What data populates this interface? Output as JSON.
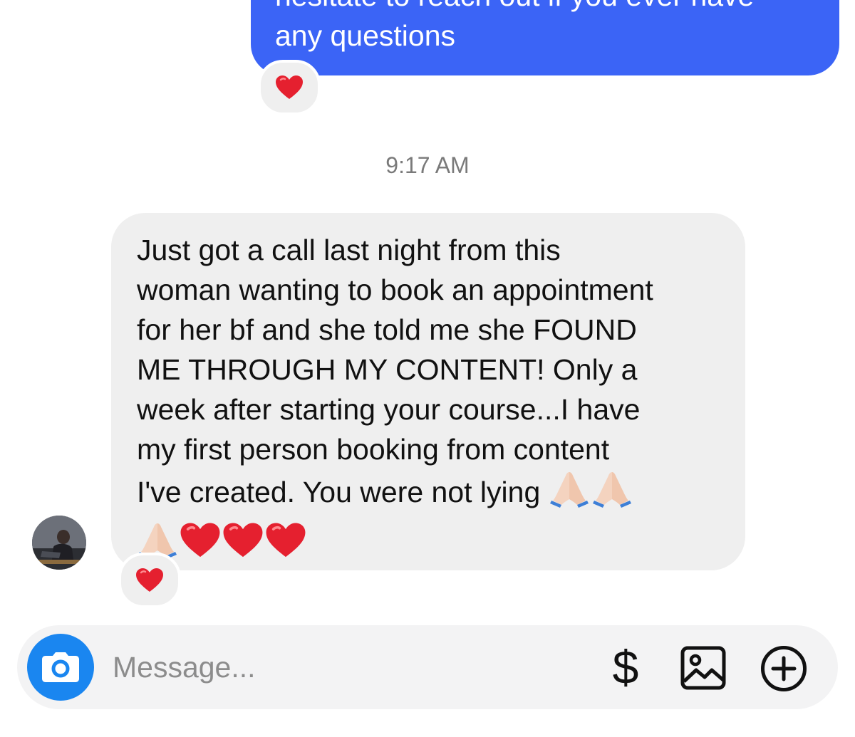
{
  "thread": {
    "sent_message": {
      "partial_line": "hesitate to reach out if you ever have",
      "last_line": "any questions",
      "reaction": "heart",
      "color": "#3b64f6"
    },
    "timestamp": "9:17 AM",
    "received_message": {
      "text": "Just got a call last night from this\nwoman wanting to book an appointment\nfor her bf and she told me she FOUND\nME THROUGH MY CONTENT! Only a\nweek after starting your course...I have\nmy first person booking from content\nI've created. You were not lying ",
      "emojis": [
        "folded-hands",
        "folded-hands",
        "folded-hands",
        "red-heart",
        "red-heart",
        "red-heart"
      ],
      "reaction": "heart"
    },
    "avatar": "sender-avatar"
  },
  "composer": {
    "placeholder": "Message...",
    "value": "",
    "dollar_label": "$",
    "camera_color": "#1a86f0"
  }
}
